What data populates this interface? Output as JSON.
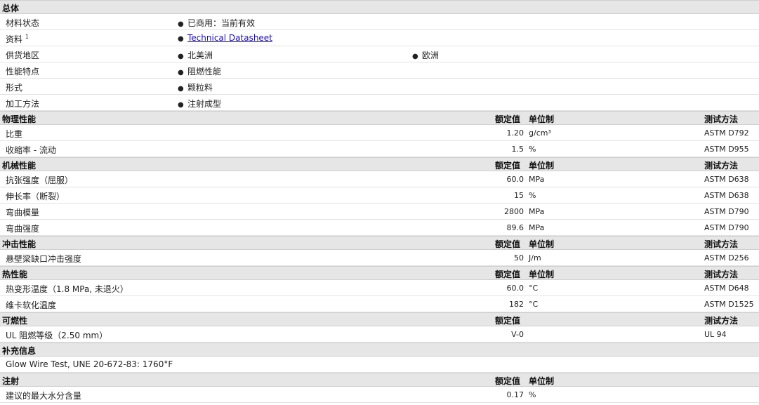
{
  "general": {
    "title": "总体",
    "rows": [
      {
        "label": "材料状态",
        "items": [
          "已商用：当前有效"
        ]
      },
      {
        "label": "资料",
        "sup": "1",
        "items": [
          "Technical Datasheet"
        ]
      },
      {
        "label": "供货地区",
        "items": [
          "北美洲",
          "欧洲"
        ]
      },
      {
        "label": "性能特点",
        "items": [
          "阻燃性能"
        ]
      },
      {
        "label": "形式",
        "items": [
          "颗粒料"
        ]
      },
      {
        "label": "加工方法",
        "items": [
          "注射成型"
        ]
      }
    ]
  },
  "col_headers": {
    "value": "额定值",
    "unit": "单位制",
    "method": "测试方法"
  },
  "physical": {
    "title": "物理性能",
    "rows": [
      {
        "label": "比重",
        "value": "1.20",
        "unit": "g/cm³",
        "method": "ASTM D792"
      },
      {
        "label": "收缩率  - 流动",
        "value": "1.5",
        "unit": "%",
        "method": "ASTM D955"
      }
    ]
  },
  "mechanical": {
    "title": "机械性能",
    "rows": [
      {
        "label": "抗张强度（屈服）",
        "value": "60.0",
        "unit": "MPa",
        "method": "ASTM D638"
      },
      {
        "label": "伸长率（断裂）",
        "value": "15",
        "unit": "%",
        "method": "ASTM D638"
      },
      {
        "label": "弯曲模量",
        "value": "2800",
        "unit": "MPa",
        "method": "ASTM D790"
      },
      {
        "label": "弯曲强度",
        "value": "89.6",
        "unit": "MPa",
        "method": "ASTM D790"
      }
    ]
  },
  "impact": {
    "title": "冲击性能",
    "rows": [
      {
        "label": "悬壁梁缺口冲击强度",
        "value": "50",
        "unit": "J/m",
        "method": "ASTM D256"
      }
    ]
  },
  "thermal": {
    "title": "热性能",
    "rows": [
      {
        "label": "热变形温度（1.8 MPa, 未退火）",
        "value": "60.0",
        "unit": "°C",
        "method": "ASTM D648"
      },
      {
        "label": "维卡软化温度",
        "value": "182",
        "unit": "°C",
        "method": "ASTM D1525"
      }
    ]
  },
  "flammability": {
    "title": "可燃性",
    "rows": [
      {
        "label": "UL 阻燃等级（2.50 mm）",
        "value": "V-0",
        "unit": "",
        "method": "UL 94"
      }
    ]
  },
  "supplemental": {
    "title": "补充信息",
    "text": "Glow Wire Test, UNE 20-672-83: 1760°F"
  },
  "injection": {
    "title": "注射",
    "rows": [
      {
        "label": "建议的最大水分含量",
        "value": "0.17",
        "unit": "%",
        "method": ""
      }
    ]
  }
}
